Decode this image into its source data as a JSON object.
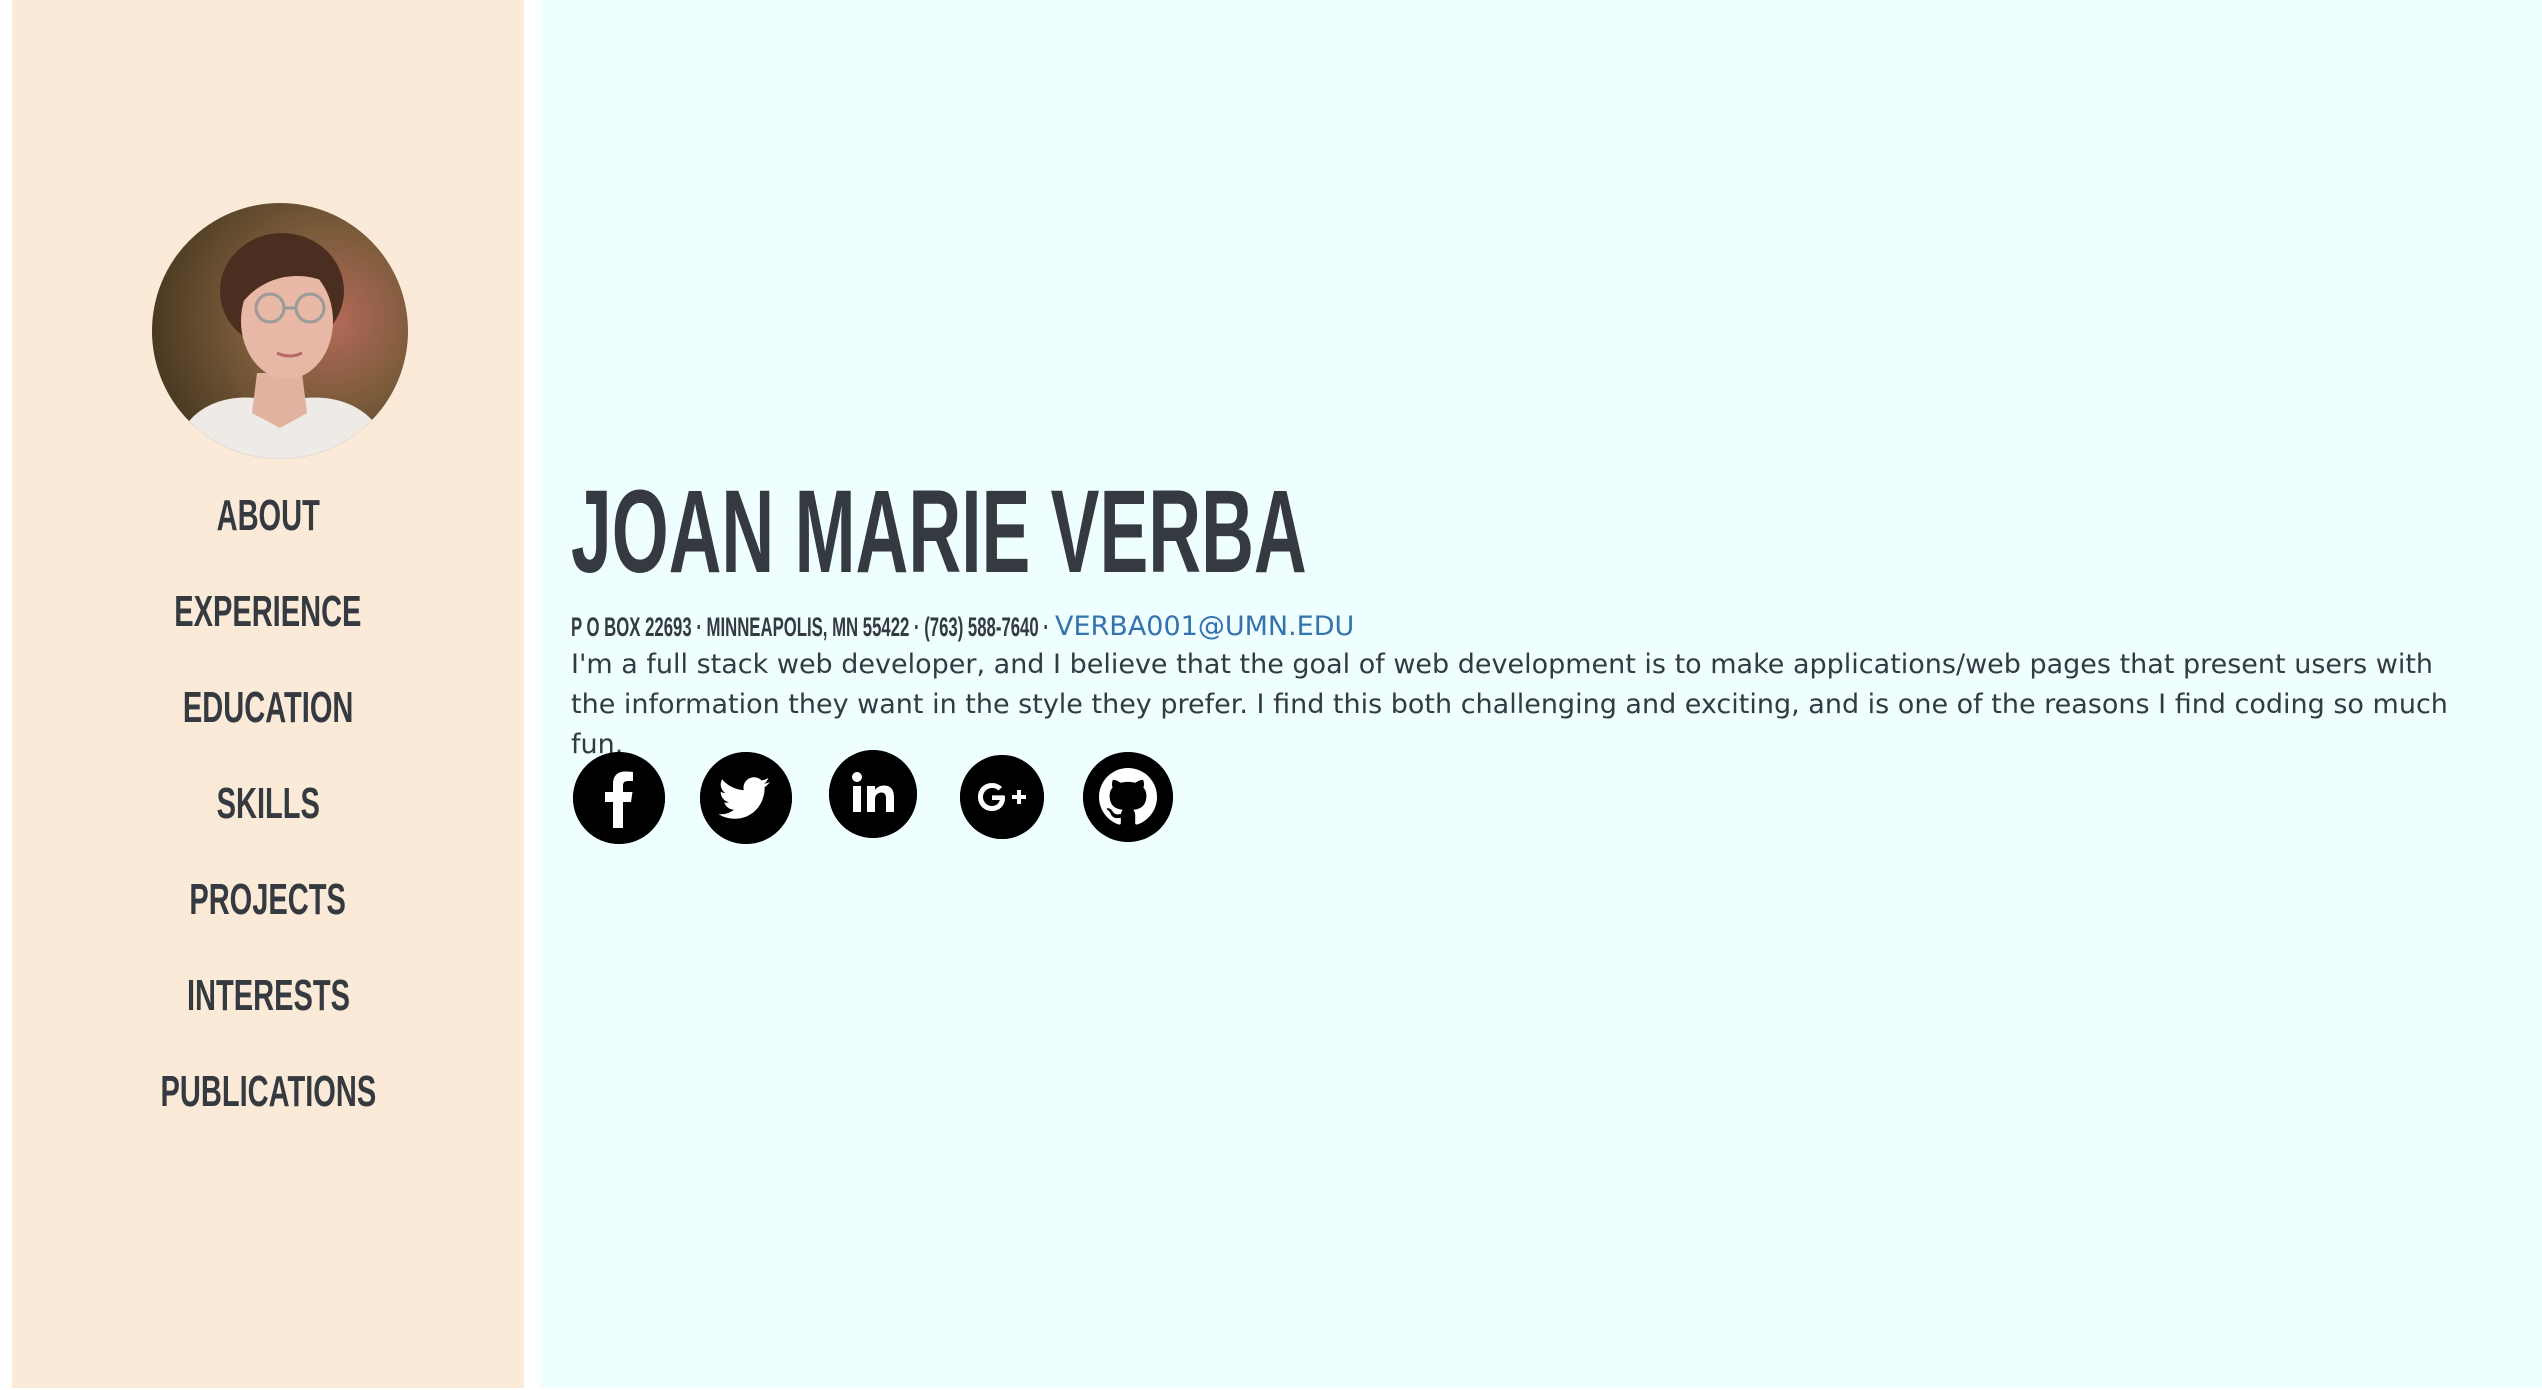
{
  "profile": {
    "photo_alt": "Profile photo of Joan Marie Verba"
  },
  "nav": {
    "items": [
      {
        "label": "About"
      },
      {
        "label": "Experience"
      },
      {
        "label": "Education"
      },
      {
        "label": "Skills"
      },
      {
        "label": "Projects"
      },
      {
        "label": "Interests"
      },
      {
        "label": "Publications"
      }
    ]
  },
  "header": {
    "name": "Joan Marie Verba",
    "address": "P O Box 22693 · Minneapolis, MN 55422 · (763) 588-7640 ·",
    "email": "VERBA001@UMN.EDU"
  },
  "intro": "I'm a full stack web developer, and I believe that the goal of web development is to make applications/web pages that present users with the information they want in the style they prefer. I find this both challenging and exciting, and is one of the reasons I find coding so much fun.",
  "social": [
    {
      "icon": "facebook-icon"
    },
    {
      "icon": "twitter-icon"
    },
    {
      "icon": "linkedin-icon"
    },
    {
      "icon": "google-plus-icon"
    },
    {
      "icon": "github-icon"
    }
  ],
  "colors": {
    "sidebar_bg": "#fbead7",
    "main_bg": "#effefe",
    "heading_text": "#343a40",
    "link": "#3572b0"
  }
}
